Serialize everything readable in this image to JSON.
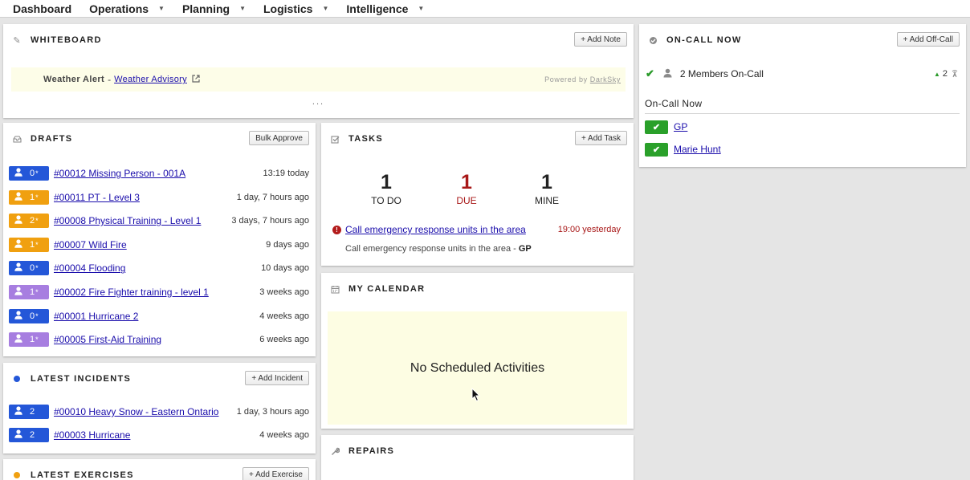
{
  "nav": {
    "items": [
      {
        "label": "Dashboard",
        "dropdown": false
      },
      {
        "label": "Operations",
        "dropdown": true
      },
      {
        "label": "Planning",
        "dropdown": true
      },
      {
        "label": "Logistics",
        "dropdown": true
      },
      {
        "label": "Intelligence",
        "dropdown": true
      }
    ]
  },
  "whiteboard": {
    "title": "WHITEBOARD",
    "add_button": "+ Add Note",
    "alert_label": "Weather Alert",
    "alert_separator": "-",
    "alert_link": "Weather Advisory",
    "powered_prefix": "Powered by",
    "powered_link": "DarkSky",
    "more": "..."
  },
  "drafts": {
    "title": "DRAFTS",
    "button": "Bulk Approve",
    "rows": [
      {
        "badge": "0",
        "color": "#2457d8",
        "link": "#00012 Missing Person - 001A",
        "time": "13:19 today"
      },
      {
        "badge": "1",
        "color": "#f0a010",
        "link": "#00011 PT - Level 3",
        "time": "1 day, 7 hours ago"
      },
      {
        "badge": "2",
        "color": "#f0a010",
        "link": "#00008 Physical Training - Level 1",
        "time": "3 days, 7 hours ago"
      },
      {
        "badge": "1",
        "color": "#f0a010",
        "link": "#00007 Wild Fire",
        "time": "9 days ago"
      },
      {
        "badge": "0",
        "color": "#2457d8",
        "link": "#00004 Flooding",
        "time": "10 days ago"
      },
      {
        "badge": "1",
        "color": "#a77ee0",
        "link": "#00002 Fire Fighter training - level 1",
        "time": "3 weeks ago"
      },
      {
        "badge": "0",
        "color": "#2457d8",
        "link": "#00001 Hurricane 2",
        "time": "4 weeks ago"
      },
      {
        "badge": "1",
        "color": "#a77ee0",
        "link": "#00005 First-Aid Training",
        "time": "6 weeks ago"
      }
    ]
  },
  "incidents": {
    "title": "LATEST INCIDENTS",
    "button": "+ Add Incident",
    "dot_color": "#2457d8",
    "rows": [
      {
        "badge": "2",
        "color": "#2457d8",
        "link": "#00010 Heavy Snow - Eastern Ontario",
        "time": "1 day, 3 hours ago"
      },
      {
        "badge": "2",
        "color": "#2457d8",
        "link": "#00003 Hurricane",
        "time": "4 weeks ago"
      }
    ]
  },
  "exercises": {
    "title": "LATEST EXERCISES",
    "button": "+ Add Exercise",
    "dot_color": "#f0a010"
  },
  "tasks": {
    "title": "TASKS",
    "button": "+ Add Task",
    "stats": [
      {
        "num": "1",
        "label": "TO DO"
      },
      {
        "num": "1",
        "label": "DUE"
      },
      {
        "num": "1",
        "label": "MINE"
      }
    ],
    "item_link": "Call emergency response units in the area",
    "item_time": "19:00 yesterday",
    "item_desc": "Call emergency response units in the area -",
    "item_owner": "GP"
  },
  "calendar": {
    "title": "MY CALENDAR",
    "empty": "No Scheduled Activities"
  },
  "repairs": {
    "title": "REPAIRS"
  },
  "oncall": {
    "title": "ON-CALL NOW",
    "button": "+ Add Off-Call",
    "summary": "2 Members On-Call",
    "count": "2",
    "subheading": "On-Call Now",
    "members": [
      "GP",
      "Marie Hunt"
    ]
  },
  "colors": {
    "accent_link": "#1a0dab",
    "due_red": "#a81818",
    "check_green": "#2aa02a"
  }
}
